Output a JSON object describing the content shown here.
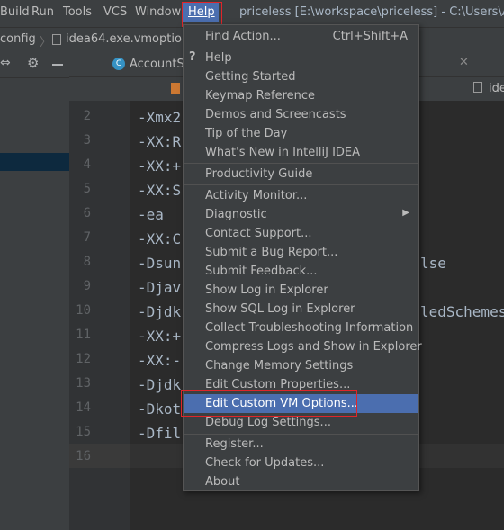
{
  "menubar": {
    "items": [
      "Build",
      "Run",
      "Tools",
      "VCS",
      "Window"
    ],
    "active": "Help",
    "title": "priceless [E:\\workspace\\priceless] - C:\\Users\\Adm"
  },
  "navbar": {
    "crumb1": "config",
    "crumb2": "idea64.exe.vmoptions"
  },
  "tabs": {
    "tab1": "AccountSe",
    "tab2": "ide"
  },
  "editor": {
    "line_numbers": [
      "2",
      "3",
      "4",
      "5",
      "6",
      "7",
      "8",
      "9",
      "10",
      "11",
      "12",
      "13",
      "14",
      "15",
      "16"
    ],
    "lines": [
      "-Xmx2",
      "-XX:R",
      "-XX:+",
      "-XX:S",
      "-ea",
      "-XX:C",
      "-Dsun",
      "-Djav",
      "-Djdk",
      "-XX:+",
      "-XX:-",
      "-Djdk",
      "-Dkot",
      "-Dfil",
      ""
    ],
    "right_text_1": "lse",
    "right_text_2": "ledSchemes"
  },
  "help_menu": {
    "items": [
      {
        "label": "Find Action...",
        "shortcut": "Ctrl+Shift+A"
      },
      {
        "label": "Help"
      },
      {
        "label": "Getting Started"
      },
      {
        "label": "Keymap Reference"
      },
      {
        "label": "Demos and Screencasts"
      },
      {
        "label": "Tip of the Day"
      },
      {
        "label": "What's New in IntelliJ IDEA"
      },
      {
        "label": "Productivity Guide"
      },
      {
        "label": "Activity Monitor..."
      },
      {
        "label": "Diagnostic"
      },
      {
        "label": "Contact Support..."
      },
      {
        "label": "Submit a Bug Report..."
      },
      {
        "label": "Submit Feedback..."
      },
      {
        "label": "Show Log in Explorer"
      },
      {
        "label": "Show SQL Log in Explorer"
      },
      {
        "label": "Collect Troubleshooting Information"
      },
      {
        "label": "Compress Logs and Show in Explorer"
      },
      {
        "label": "Change Memory Settings"
      },
      {
        "label": "Edit Custom Properties..."
      },
      {
        "label": "Edit Custom VM Options..."
      },
      {
        "label": "Debug Log Settings..."
      },
      {
        "label": "Register..."
      },
      {
        "label": "Check for Updates..."
      },
      {
        "label": "About"
      }
    ],
    "highlighted": "Edit Custom VM Options..."
  },
  "colors": {
    "highlight": "#4b6eaf",
    "annotation_box": "#e0252a",
    "background": "#2b2b2b"
  }
}
